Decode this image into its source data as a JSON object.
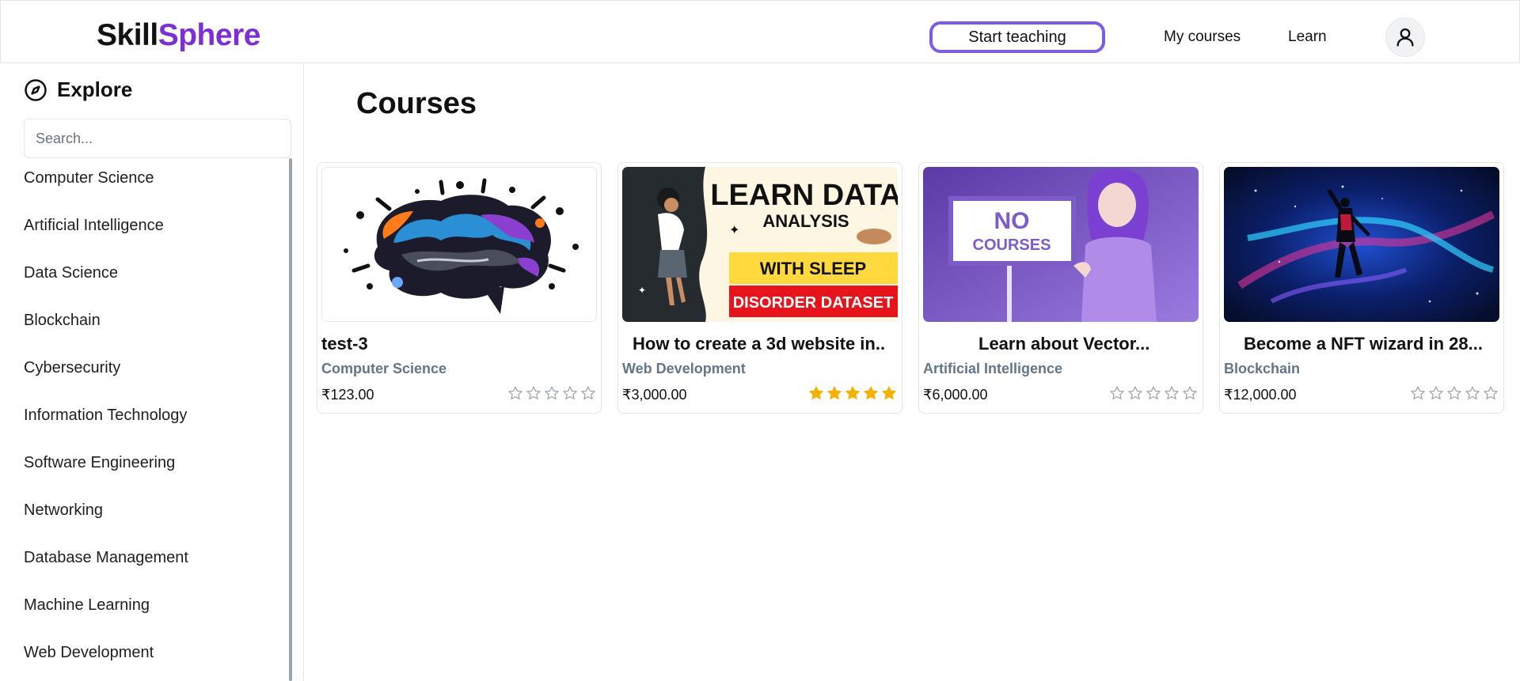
{
  "header": {
    "logo_part1": "Skill",
    "logo_part2": "Sphere",
    "start_teaching": "Start teaching",
    "my_courses": "My courses",
    "learn": "Learn",
    "avatar_icon": "user-icon"
  },
  "sidebar": {
    "explore_icon": "compass-icon",
    "explore_title": "Explore",
    "search_placeholder": "Search...",
    "categories": [
      "Computer Science",
      "Artificial Intelligence",
      "Data Science",
      "Blockchain",
      "Cybersecurity",
      "Information Technology",
      "Software Engineering",
      "Networking",
      "Database Management",
      "Machine Learning",
      "Web Development"
    ]
  },
  "main": {
    "title": "Courses",
    "courses": [
      {
        "title": "test-3",
        "category": "Computer Science",
        "price": "₹123.00",
        "rating": 0,
        "image": "brain-illustration"
      },
      {
        "title": "How to create a 3d website in..",
        "category": "Web Development",
        "price": "₹3,000.00",
        "rating": 5,
        "image": "data-analysis-banner",
        "image_text": {
          "line1": "LEARN DATA",
          "line2": "ANALYSIS",
          "line3": "WITH SLEEP",
          "line4": "DISORDER DATASET"
        }
      },
      {
        "title": "Learn about Vector...",
        "category": "Artificial Intelligence",
        "price": "₹6,000.00",
        "rating": 0,
        "image": "no-courses-sign",
        "image_text": {
          "line1": "NO",
          "line2": "COURSES"
        }
      },
      {
        "title": "Become a NFT wizard in 28...",
        "category": "Blockchain",
        "price": "₹12,000.00",
        "rating": 0,
        "image": "space-explosion"
      }
    ]
  },
  "colors": {
    "brand_purple": "#7c2fd6",
    "teach_border": "#7b5ce8",
    "category_text": "#64748b",
    "star_filled": "#f5b000",
    "star_empty": "#9ca3af"
  }
}
